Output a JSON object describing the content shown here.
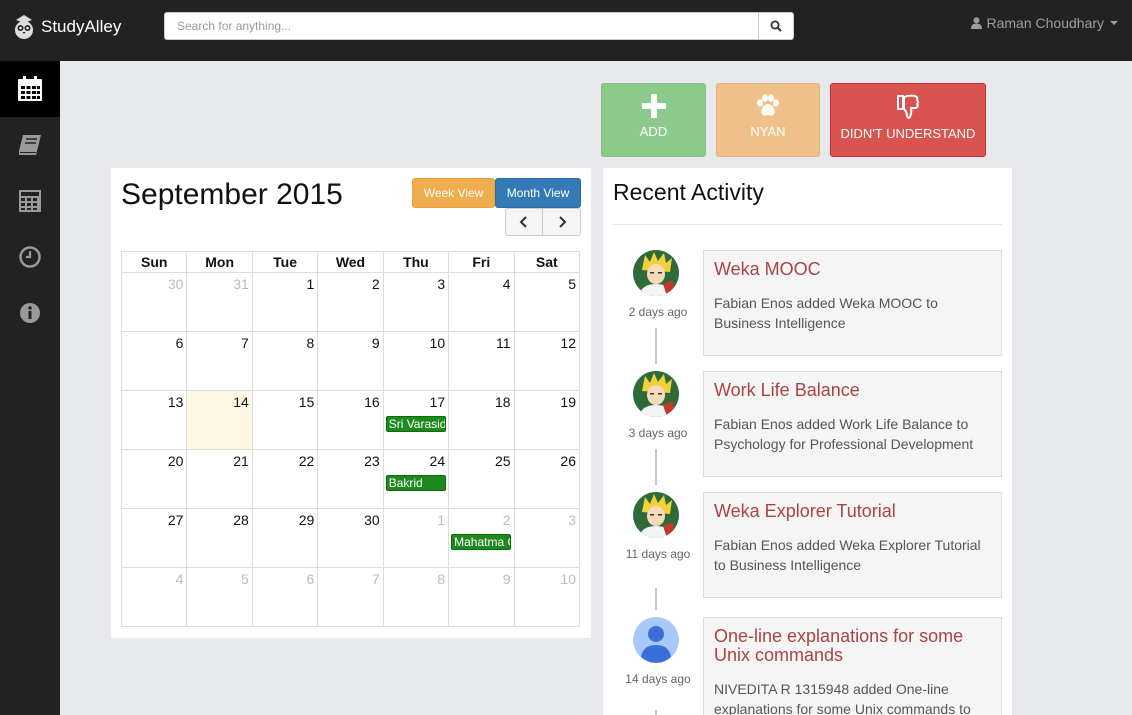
{
  "brand": {
    "name": "StudyAlley"
  },
  "search": {
    "placeholder": "Search for anything..."
  },
  "user": {
    "name": "Raman Choudhary"
  },
  "sidebar": {
    "items": [
      {
        "icon": "calendar-icon",
        "active": true
      },
      {
        "icon": "book-icon",
        "active": false
      },
      {
        "icon": "calculator-icon",
        "active": false
      },
      {
        "icon": "clock-icon",
        "active": false
      },
      {
        "icon": "info-icon",
        "active": false
      }
    ]
  },
  "actions": {
    "add": "ADD",
    "nyan": "NYAN",
    "didnt_understand": "DIDN'T UNDERSTAND"
  },
  "calendar": {
    "title": "September 2015",
    "week_view": "Week View",
    "month_view": "Month View",
    "weekdays": [
      "Sun",
      "Mon",
      "Tue",
      "Wed",
      "Thu",
      "Fri",
      "Sat"
    ],
    "weeks": [
      [
        {
          "d": "30",
          "m": true
        },
        {
          "d": "31",
          "m": true
        },
        {
          "d": "1"
        },
        {
          "d": "2"
        },
        {
          "d": "3"
        },
        {
          "d": "4"
        },
        {
          "d": "5"
        }
      ],
      [
        {
          "d": "6"
        },
        {
          "d": "7"
        },
        {
          "d": "8"
        },
        {
          "d": "9"
        },
        {
          "d": "10"
        },
        {
          "d": "11"
        },
        {
          "d": "12"
        }
      ],
      [
        {
          "d": "13"
        },
        {
          "d": "14",
          "today": true
        },
        {
          "d": "15"
        },
        {
          "d": "16"
        },
        {
          "d": "17",
          "event": "Sri Varasidhi Vinayaka Vratham"
        },
        {
          "d": "18"
        },
        {
          "d": "19"
        }
      ],
      [
        {
          "d": "20"
        },
        {
          "d": "21"
        },
        {
          "d": "22"
        },
        {
          "d": "23"
        },
        {
          "d": "24",
          "event": "Bakrid"
        },
        {
          "d": "25"
        },
        {
          "d": "26"
        }
      ],
      [
        {
          "d": "27"
        },
        {
          "d": "28"
        },
        {
          "d": "29"
        },
        {
          "d": "30"
        },
        {
          "d": "1",
          "m": true
        },
        {
          "d": "2",
          "m": true,
          "event": "Mahatma Gandhi Jayanti"
        },
        {
          "d": "3",
          "m": true
        }
      ],
      [
        {
          "d": "4",
          "m": true
        },
        {
          "d": "5",
          "m": true
        },
        {
          "d": "6",
          "m": true
        },
        {
          "d": "7",
          "m": true
        },
        {
          "d": "8",
          "m": true
        },
        {
          "d": "9",
          "m": true
        },
        {
          "d": "10",
          "m": true
        }
      ]
    ]
  },
  "activity": {
    "title": "Recent Activity",
    "items": [
      {
        "title": "Weka MOOC",
        "ago": "2 days ago",
        "text": "Fabian Enos added Weka MOOC to Business Intelligence",
        "avatar": "anime-avatar"
      },
      {
        "title": "Work Life Balance",
        "ago": "3 days ago",
        "text": "Fabian Enos added Work Life Balance to Psychology for Professional Development",
        "avatar": "anime-avatar"
      },
      {
        "title": "Weka Explorer Tutorial",
        "ago": "11 days ago",
        "text": "Fabian Enos added Weka Explorer Tutorial to Business Intelligence",
        "avatar": "anime-avatar"
      },
      {
        "title": "One-line explanations for some Unix commands",
        "ago": "14 days ago",
        "text": "NIVEDITA R 1315948 added One-line explanations for some Unix commands to",
        "avatar": "default-avatar"
      }
    ]
  }
}
